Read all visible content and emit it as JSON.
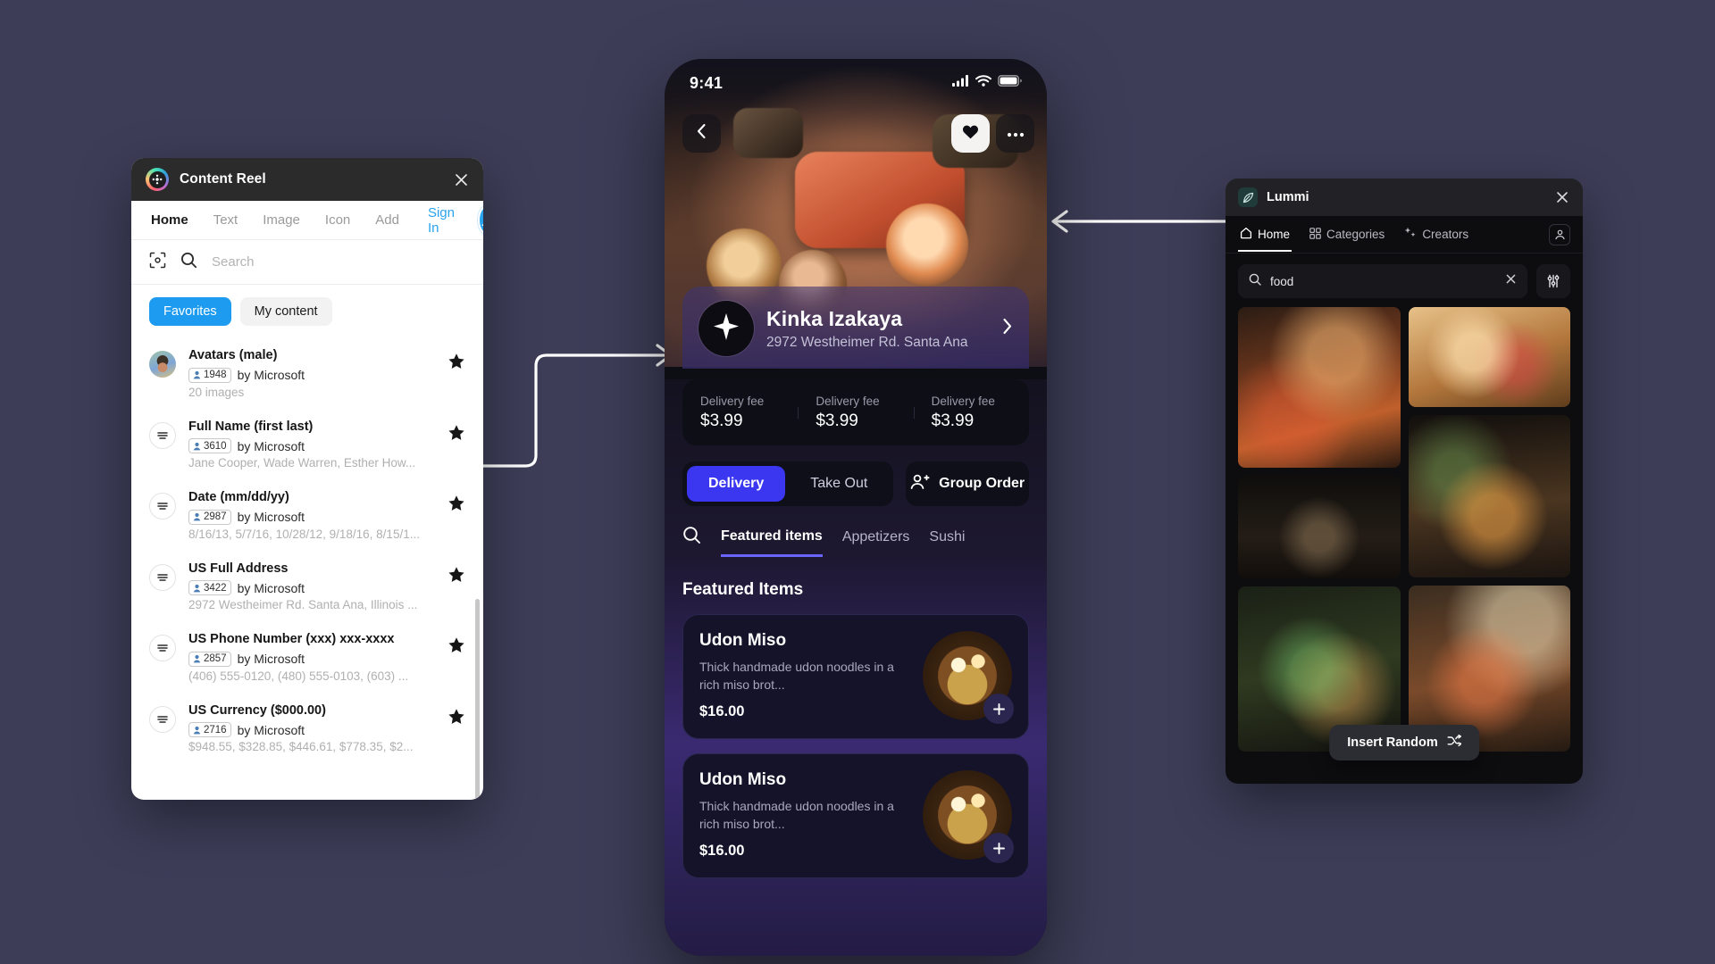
{
  "canvas": {
    "background": "#3d3d58"
  },
  "content_reel": {
    "title": "Content Reel",
    "logo_icon": "content-reel-logo",
    "close_icon": "close-icon",
    "tabs": [
      {
        "label": "Home",
        "active": true
      },
      {
        "label": "Text",
        "active": false
      },
      {
        "label": "Image",
        "active": false
      },
      {
        "label": "Icon",
        "active": false
      },
      {
        "label": "Add",
        "active": false
      },
      {
        "label": "Sign In",
        "active": false,
        "accent": "#2aa3ef"
      }
    ],
    "avatar_icon": "user-avatar-icon",
    "scan_icon": "scan-icon",
    "search_icon": "search-icon",
    "search": {
      "placeholder": "Search",
      "value": ""
    },
    "chips": [
      {
        "label": "Favorites",
        "selected": true
      },
      {
        "label": "My content",
        "selected": false
      }
    ],
    "items": [
      {
        "name": "Avatars (male)",
        "count": "1948",
        "author": "by Microsoft",
        "preview": "20 images",
        "thumb": "avatar-photo",
        "starred": true
      },
      {
        "name": "Full Name (first last)",
        "count": "3610",
        "author": "by Microsoft",
        "preview": "Jane Cooper, Wade Warren, Esther How...",
        "thumb": "text-list-icon",
        "starred": true
      },
      {
        "name": "Date (mm/dd/yy)",
        "count": "2987",
        "author": "by Microsoft",
        "preview": "8/16/13, 5/7/16, 10/28/12, 9/18/16, 8/15/1...",
        "thumb": "text-list-icon",
        "starred": true
      },
      {
        "name": "US Full Address",
        "count": "3422",
        "author": "by Microsoft",
        "preview": "2972 Westheimer Rd. Santa Ana, Illinois ...",
        "thumb": "text-list-icon",
        "starred": true
      },
      {
        "name": "US Phone Number (xxx) xxx-xxxx",
        "count": "2857",
        "author": "by Microsoft",
        "preview": "(406) 555-0120, (480) 555-0103, (603) ...",
        "thumb": "text-list-icon",
        "starred": true
      },
      {
        "name": "US Currency ($000.00)",
        "count": "2716",
        "author": "by Microsoft",
        "preview": "$948.55, $328.85, $446.61, $778.35, $2...",
        "thumb": "text-list-icon",
        "starred": true
      }
    ]
  },
  "phone": {
    "status": {
      "time": "9:41",
      "cellular_icon": "signal-bars-icon",
      "wifi_icon": "wifi-icon",
      "battery_icon": "battery-icon"
    },
    "hero": {
      "back_icon": "chevron-left-icon",
      "favorite_icon": "heart-icon",
      "more_icon": "more-dots-icon"
    },
    "restaurant": {
      "name": "Kinka Izakaya",
      "address": "2972 Westheimer Rd. Santa Ana",
      "logo_icon": "star-burst-icon",
      "chevron_icon": "chevron-right-icon"
    },
    "fees": [
      {
        "label": "Delivery fee",
        "value": "$3.99"
      },
      {
        "label": "Delivery fee",
        "value": "$3.99"
      },
      {
        "label": "Delivery fee",
        "value": "$3.99"
      }
    ],
    "order_modes": [
      {
        "label": "Delivery",
        "active": true
      },
      {
        "label": "Take Out",
        "active": false
      }
    ],
    "group_order": {
      "label": "Group Order",
      "icon": "group-people-icon"
    },
    "menu_search_icon": "search-icon",
    "menu_tabs": [
      {
        "label": "Featured items",
        "active": true
      },
      {
        "label": "Appetizers",
        "active": false
      },
      {
        "label": "Sushi",
        "active": false
      }
    ],
    "featured_heading": "Featured Items",
    "dishes": [
      {
        "name": "Udon Miso",
        "description": "Thick handmade udon noodles in a rich miso brot...",
        "price": "$16.00",
        "add_icon": "plus-icon"
      },
      {
        "name": "Udon Miso",
        "description": "Thick handmade udon noodles in a rich miso brot...",
        "price": "$16.00",
        "add_icon": "plus-icon"
      }
    ]
  },
  "lummi": {
    "title": "Lummi",
    "logo_icon": "lummi-leaf-icon",
    "close_icon": "close-icon",
    "nav": [
      {
        "label": "Home",
        "icon": "home-icon",
        "active": true
      },
      {
        "label": "Categories",
        "icon": "grid-icon",
        "active": false
      },
      {
        "label": "Creators",
        "icon": "sparkle-icon",
        "active": false
      }
    ],
    "profile_icon": "user-icon",
    "search": {
      "value": "food",
      "placeholder": "Search",
      "icon": "search-icon",
      "clear_icon": "clear-x-icon"
    },
    "filter_icon": "sliders-icon",
    "insert_random": {
      "label": "Insert Random",
      "icon": "shuffle-icon"
    },
    "grid": [
      {
        "id": "market-cooking",
        "accent": "#b25a2a"
      },
      {
        "id": "dark-spices",
        "accent": "#2a2018"
      },
      {
        "id": "cheese-board",
        "accent": "#c08a4a"
      },
      {
        "id": "herb-table",
        "accent": "#7d5a2e"
      },
      {
        "id": "noodle-pot",
        "accent": "#3d6b3a"
      },
      {
        "id": "pasta-window",
        "accent": "#b8663a"
      }
    ]
  },
  "connectors": {
    "left_arrow_label": "content-reel-to-phone",
    "right_arrow_label": "lummi-to-phone"
  }
}
